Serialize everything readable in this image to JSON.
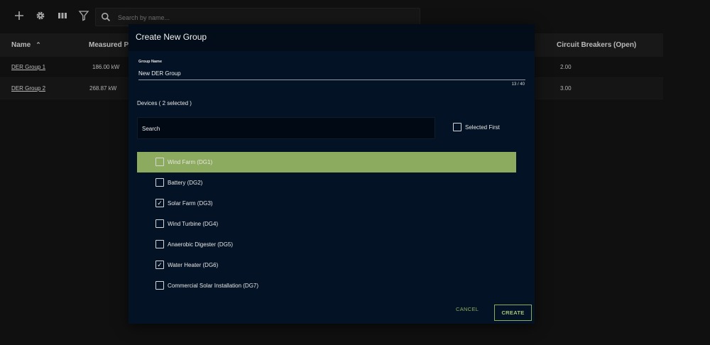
{
  "toolbar": {
    "icons": [
      "plus-icon",
      "gear-icon",
      "columns-icon",
      "filter-icon"
    ],
    "search_placeholder": "Search by name..."
  },
  "table": {
    "columns": {
      "name": "Name",
      "measured_power": "Measured Po",
      "circuit_breakers": "Circuit Breakers (Open)"
    },
    "sort_direction": "ascending",
    "rows": [
      {
        "name": "DER Group 1",
        "measured_power": "186.00 kW",
        "circuit_breakers": "2.00"
      },
      {
        "name": "DER Group 2",
        "measured_power": "268.87 kW",
        "circuit_breakers": "3.00"
      }
    ]
  },
  "dialog": {
    "title": "Create New Group",
    "group_name_label": "Group Name",
    "group_name_value": "New DER Group",
    "char_count": "13 / 40",
    "devices_heading": "Devices ( 2 selected )",
    "device_search_placeholder": "Search",
    "selected_first_label": "Selected First",
    "selected_first_checked": false,
    "devices": [
      {
        "label": "Wind Farm (DG1)",
        "checked": false,
        "highlighted": true
      },
      {
        "label": "Battery (DG2)",
        "checked": false,
        "highlighted": false
      },
      {
        "label": "Solar Farm (DG3)",
        "checked": true,
        "highlighted": false
      },
      {
        "label": "Wind Turbine (DG4)",
        "checked": false,
        "highlighted": false
      },
      {
        "label": "Anaerobic Digester (DG5)",
        "checked": false,
        "highlighted": false
      },
      {
        "label": "Water Heater (DG6)",
        "checked": true,
        "highlighted": false
      },
      {
        "label": "Commercial Solar Installation (DG7)",
        "checked": false,
        "highlighted": false
      }
    ],
    "cancel_label": "CANCEL",
    "create_label": "CREATE"
  },
  "colors": {
    "accent": "#8dab5e",
    "dialog_bg": "#031224",
    "page_bg": "#141414"
  }
}
